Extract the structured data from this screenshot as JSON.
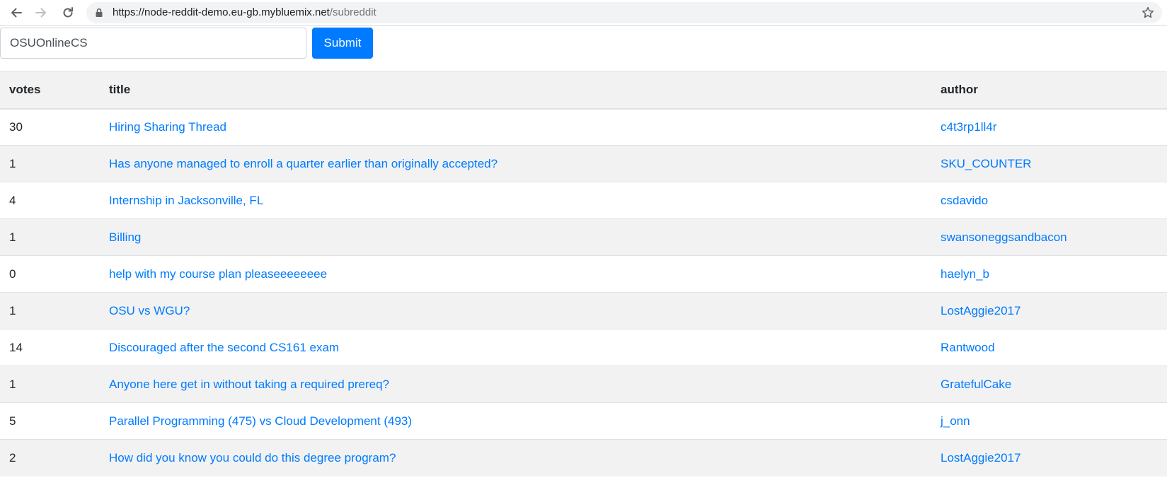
{
  "browser": {
    "url_host": "https://node-reddit-demo.eu-gb.mybluemix.net",
    "url_path": "/subreddit"
  },
  "search": {
    "value": "OSUOnlineCS",
    "submit_label": "Submit"
  },
  "table": {
    "headers": [
      "votes",
      "title",
      "author"
    ],
    "rows": [
      {
        "votes": "30",
        "title": "Hiring Sharing Thread",
        "author": "c4t3rp1ll4r"
      },
      {
        "votes": "1",
        "title": "Has anyone managed to enroll a quarter earlier than originally accepted?",
        "author": "SKU_COUNTER"
      },
      {
        "votes": "4",
        "title": "Internship in Jacksonville, FL",
        "author": "csdavido"
      },
      {
        "votes": "1",
        "title": "Billing",
        "author": "swansoneggsandbacon"
      },
      {
        "votes": "0",
        "title": "help with my course plan pleaseeeeeeee",
        "author": "haelyn_b"
      },
      {
        "votes": "1",
        "title": "OSU vs WGU?",
        "author": "LostAggie2017"
      },
      {
        "votes": "14",
        "title": "Discouraged after the second CS161 exam",
        "author": "Rantwood"
      },
      {
        "votes": "1",
        "title": "Anyone here get in without taking a required prereq?",
        "author": "GratefulCake"
      },
      {
        "votes": "5",
        "title": "Parallel Programming (475) vs Cloud Development (493)",
        "author": "j_onn"
      },
      {
        "votes": "2",
        "title": "How did you know you could do this degree program?",
        "author": "LostAggie2017"
      }
    ]
  },
  "icons": {
    "back": "back-arrow-icon",
    "forward": "forward-arrow-icon",
    "reload": "reload-icon",
    "lock": "lock-icon",
    "star": "star-icon"
  },
  "colors": {
    "link": "#007bff",
    "button": "#007bff",
    "stripe": "#f2f2f2"
  }
}
